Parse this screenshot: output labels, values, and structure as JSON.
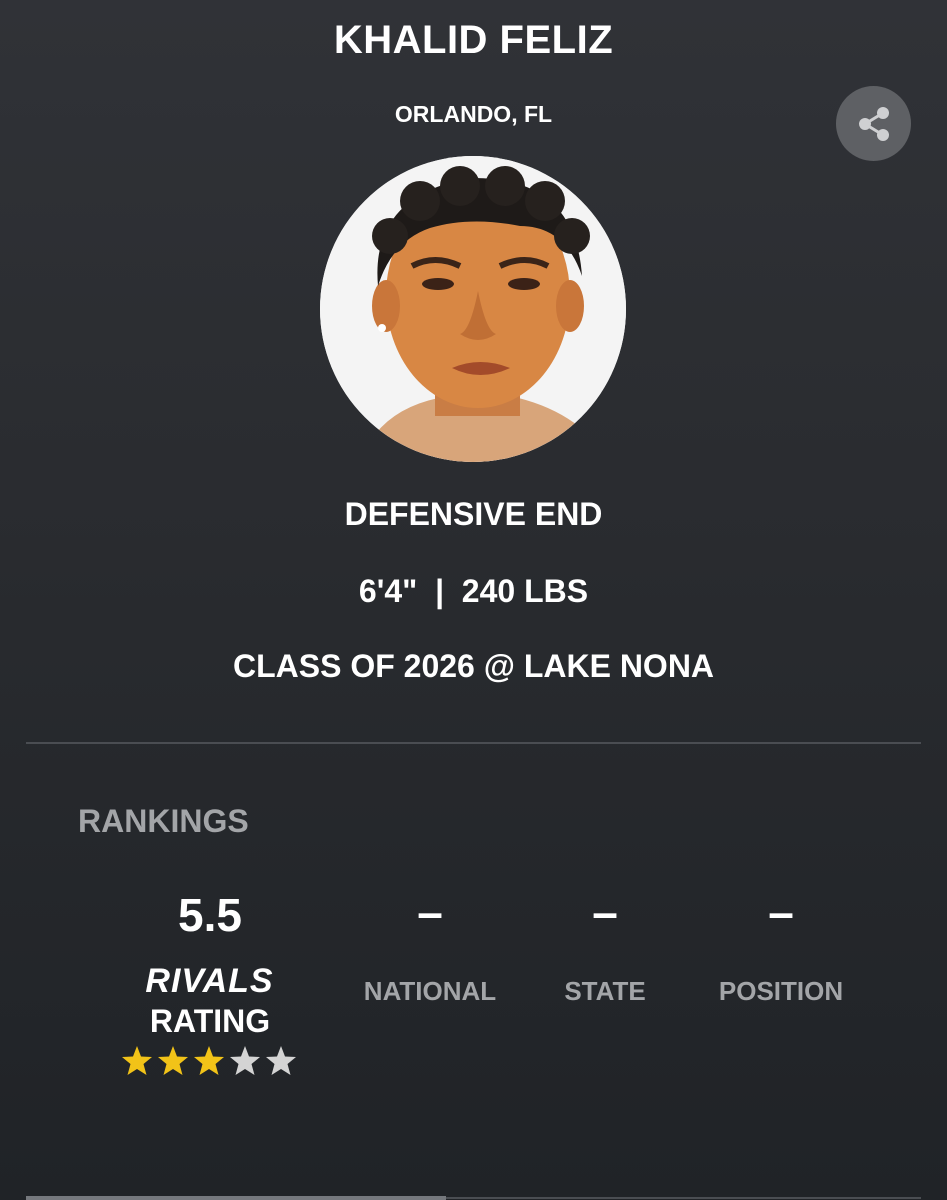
{
  "profile": {
    "name": "KHALID FELIZ",
    "location": "ORLANDO, FL",
    "position": "DEFENSIVE END",
    "height": "6'4\"",
    "separator": "|",
    "weight": "240 LBS",
    "class_line": "CLASS OF 2026 @ LAKE NONA",
    "avatar_icon": "player-headshot",
    "share_icon": "share-icon"
  },
  "rankings": {
    "title": "RANKINGS",
    "rating": {
      "value": "5.5",
      "brand": "RIVALS",
      "label": "RATING",
      "stars_filled": 3,
      "stars_total": 5
    },
    "columns": [
      {
        "value": "–",
        "label": "NATIONAL"
      },
      {
        "value": "–",
        "label": "STATE"
      },
      {
        "value": "–",
        "label": "POSITION"
      }
    ]
  },
  "colors": {
    "background_top": "#303237",
    "background_bottom": "#202327",
    "text_primary": "#ffffff",
    "text_muted": "#a3a5a8",
    "star_filled": "#f2c318",
    "star_empty": "#d4d4d4",
    "share_button": "#5e6064"
  }
}
